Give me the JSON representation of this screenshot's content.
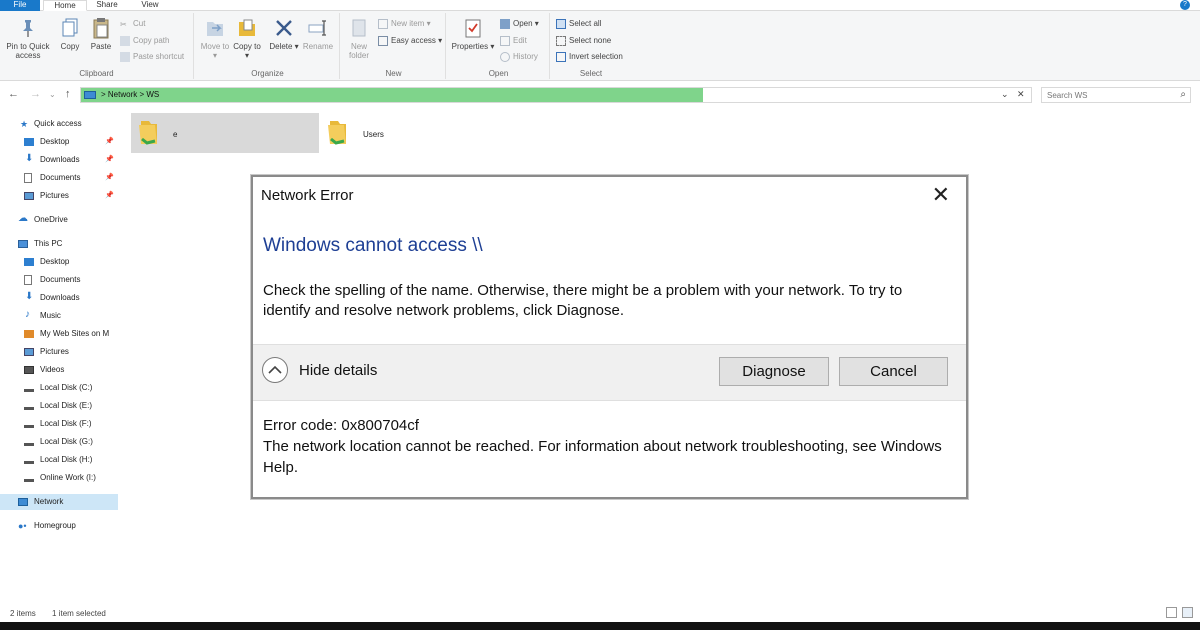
{
  "ribbon_tabs": [
    "File",
    "Home",
    "Share",
    "View"
  ],
  "clipboard": {
    "pin_label": "Pin to Quick access",
    "copy_label": "Copy",
    "paste_label": "Paste",
    "cut_label": "Cut",
    "copy_path_label": "Copy path",
    "paste_shortcut_label": "Paste shortcut",
    "group_label": "Clipboard"
  },
  "organize": {
    "move_to_label": "Move to ▾",
    "copy_to_label": "Copy to ▾",
    "delete_label": "Delete ▾",
    "rename_label": "Rename",
    "group_label": "Organize"
  },
  "new_group": {
    "new_folder_label": "New folder",
    "new_item_label": "New item ▾",
    "easy_access_label": "Easy access ▾",
    "group_label": "New"
  },
  "open_group": {
    "properties_label": "Properties ▾",
    "open_label": "Open ▾",
    "edit_label": "Edit",
    "history_label": "History",
    "group_label": "Open"
  },
  "select_group": {
    "select_all_label": "Select all",
    "select_none_label": "Select none",
    "invert_label": "Invert selection",
    "group_label": "Select"
  },
  "address": {
    "path": ">  Network  >  WS",
    "search_placeholder": "Search WS"
  },
  "nav": {
    "quick_access": "Quick access",
    "qa_items": [
      "Desktop",
      "Downloads",
      "Documents",
      "Pictures"
    ],
    "onedrive": "OneDrive",
    "this_pc": "This PC",
    "pc_items": [
      "Desktop",
      "Documents",
      "Downloads",
      "Music",
      "My Web Sites on M",
      "Pictures",
      "Videos",
      "Local Disk (C:)",
      "Local Disk (E:)",
      "Local Disk (F:)",
      "Local Disk (G:)",
      "Local Disk (H:)",
      "Online Work (I:)"
    ],
    "network": "Network",
    "homegroup": "Homegroup"
  },
  "content": {
    "folders": [
      "e",
      "Users"
    ]
  },
  "status": {
    "items": "2 items",
    "selected": "1 item selected"
  },
  "dialog": {
    "title": "Network Error",
    "heading": "Windows cannot access \\\\",
    "body": "Check the spelling of the name. Otherwise, there might be a problem with your network. To try to identify and resolve network problems, click Diagnose.",
    "hide_details": "Hide details",
    "diagnose": "Diagnose",
    "cancel": "Cancel",
    "error_code": "Error code: 0x800704cf",
    "error_detail": "The network location cannot be reached. For information about network troubleshooting, see Windows Help."
  },
  "colors": {
    "accent": "#1979ca",
    "address_progress": "#7fd48b",
    "dialog_heading": "#1e3f94",
    "folder": "#e8b93a",
    "selected_nav": "#cde6f7"
  }
}
